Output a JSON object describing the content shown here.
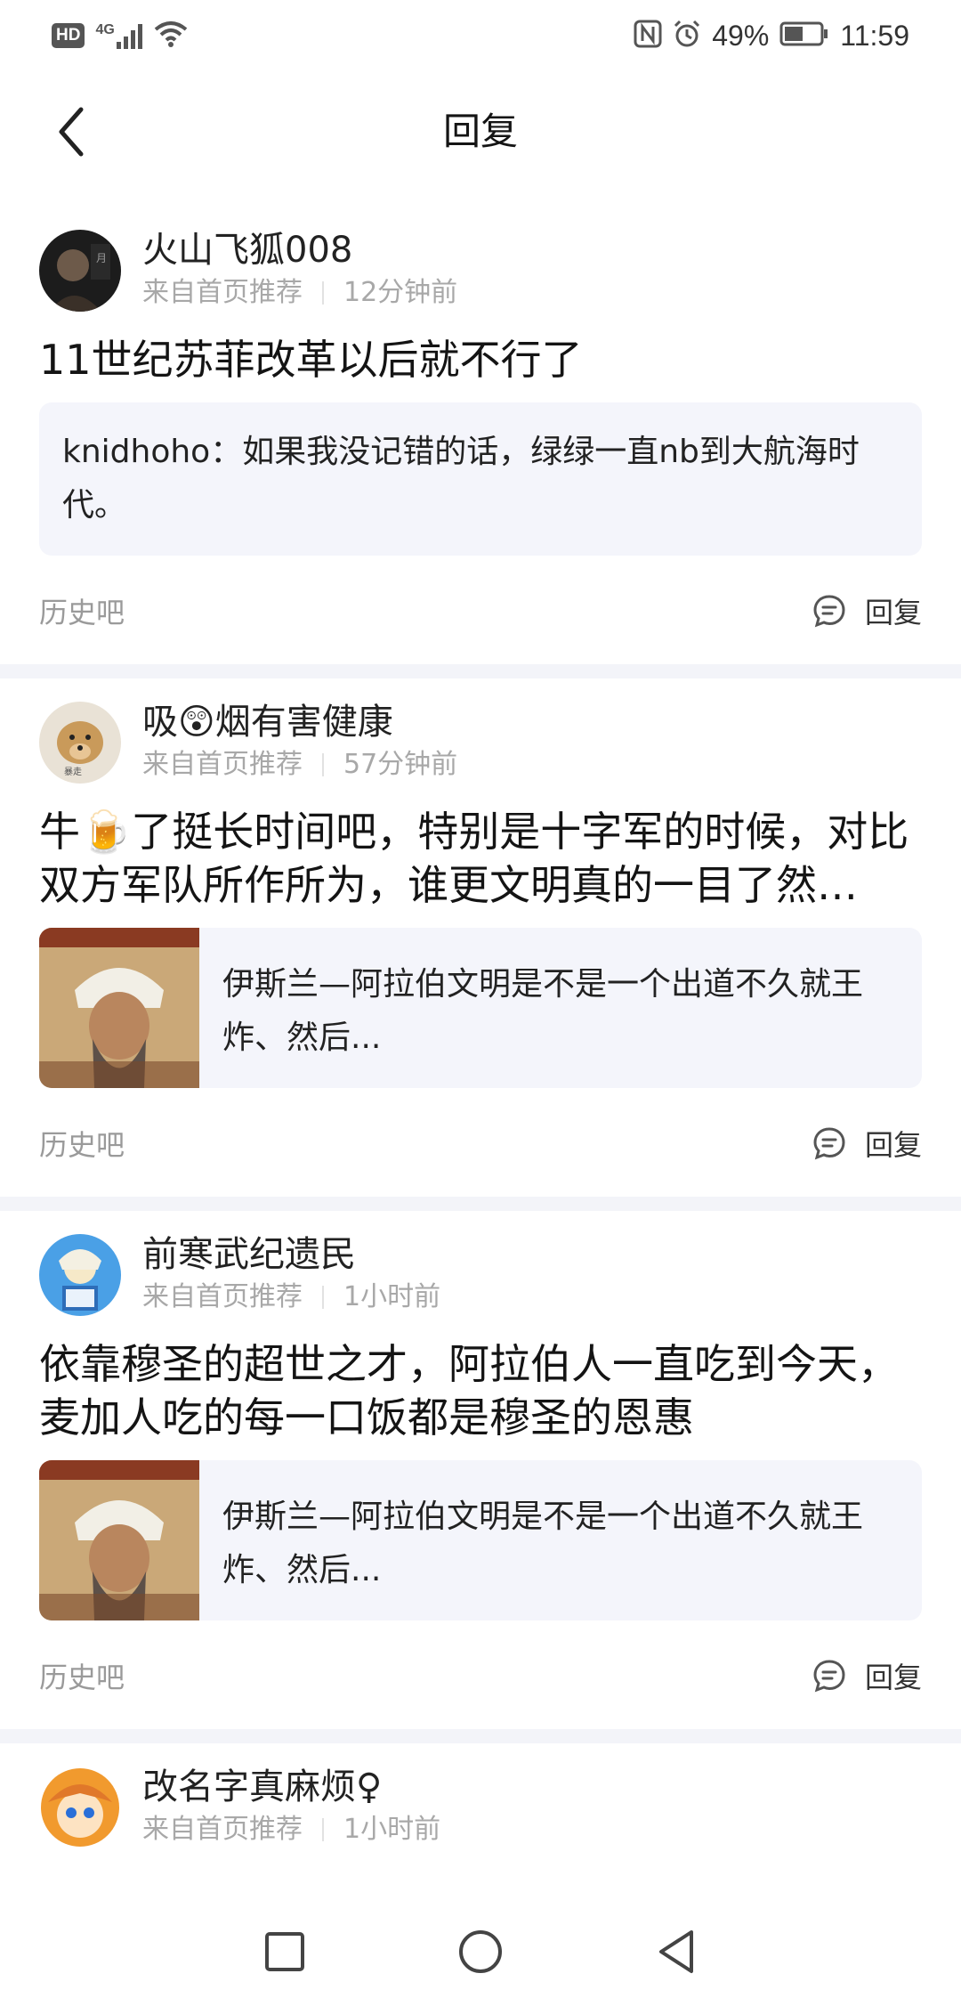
{
  "status_bar": {
    "hd": "HD",
    "network": "4G",
    "battery": "49%",
    "time": "11:59"
  },
  "header": {
    "title": "回复"
  },
  "posts": [
    {
      "username": "火山飞狐008",
      "source": "来自首页推荐",
      "time": "12分钟前",
      "content": "11世纪苏菲改革以后就不行了",
      "quote": "knidhoho：如果我没记错的话，绿绿一直nb到大航海时代。",
      "tag": "历史吧",
      "reply_label": "回复"
    },
    {
      "username": "吸😲烟有害健康",
      "source": "来自首页推荐",
      "time": "57分钟前",
      "content": "牛🍺了挺长时间吧，特别是十字军的时候，对比双方军队所作所为，谁更文明真的一目了然…",
      "link_text": "伊斯兰—阿拉伯文明是不是一个出道不久就王炸、然后...",
      "tag": "历史吧",
      "reply_label": "回复"
    },
    {
      "username": "前寒武纪遗民",
      "source": "来自首页推荐",
      "time": "1小时前",
      "content": "依靠穆圣的超世之才，阿拉伯人一直吃到今天，麦加人吃的每一口饭都是穆圣的恩惠",
      "link_text": "伊斯兰—阿拉伯文明是不是一个出道不久就王炸、然后...",
      "tag": "历史吧",
      "reply_label": "回复"
    },
    {
      "username": "改名字真麻烦♀",
      "source": "来自首页推荐",
      "time": "1小时前"
    }
  ],
  "icons": {
    "back": "chevron-left-icon",
    "reply": "comment-icon",
    "nav": [
      "square-icon",
      "circle-icon",
      "triangle-back-icon"
    ]
  },
  "colors": {
    "quote_bg": "#f4f5fb",
    "muted_text": "#a8a8a8",
    "divider": "#f3f4f9"
  }
}
